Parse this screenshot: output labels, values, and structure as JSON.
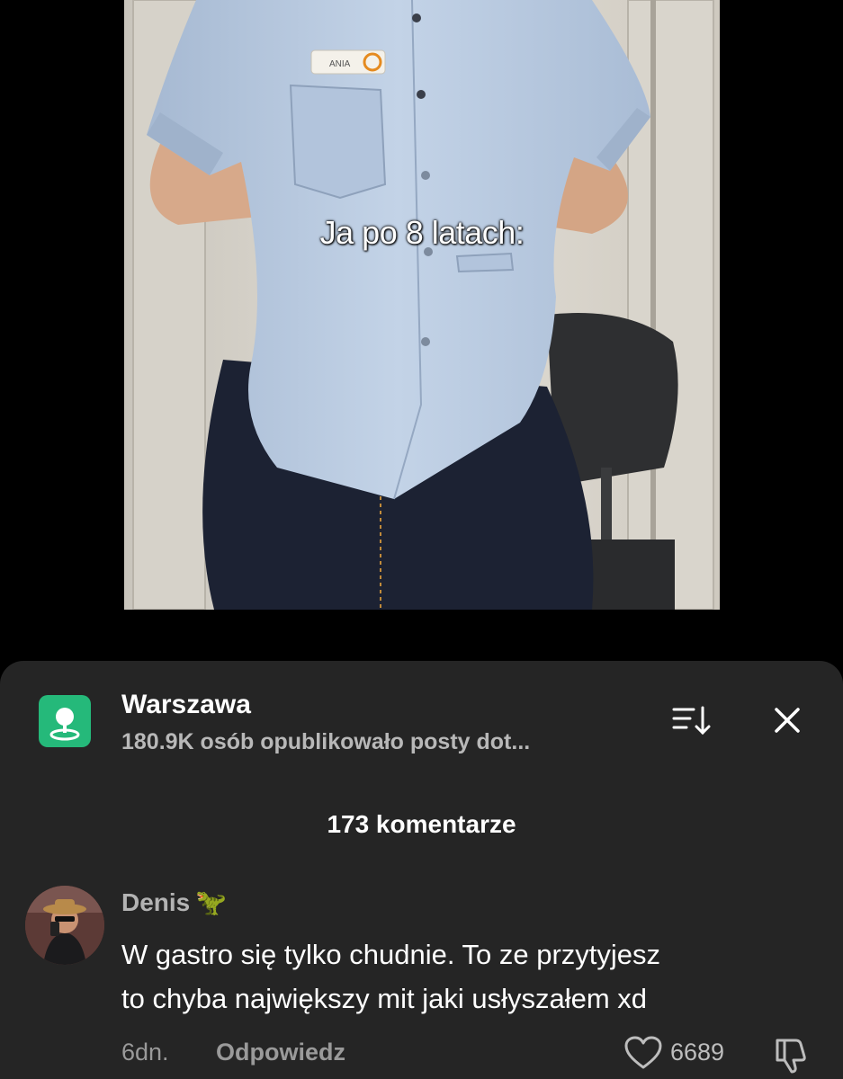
{
  "video": {
    "caption": "Ja po 8 latach:",
    "name_tag": "ANIA"
  },
  "location": {
    "icon": "location-pin-icon",
    "title": "Warszawa",
    "subtitle": "180.9K osób opublikowało posty dot..."
  },
  "header": {
    "sort_icon": "sort-icon",
    "close_icon": "close-icon",
    "comment_count": "173 komentarze"
  },
  "comments": [
    {
      "username": "Denis",
      "emoji": "🦖",
      "text_line1": "W gastro się tylko chudnie. To ze przytyjesz",
      "text_line2": "to chyba największy mit jaki usłyszałem xd",
      "time": "6dn.",
      "reply_label": "Odpowiedz",
      "likes": "6689"
    }
  ],
  "colors": {
    "sheet_bg": "#252525",
    "location_icon_bg": "#25b97a",
    "shirt": "#b9cbe2",
    "jeans": "#1c2233"
  }
}
